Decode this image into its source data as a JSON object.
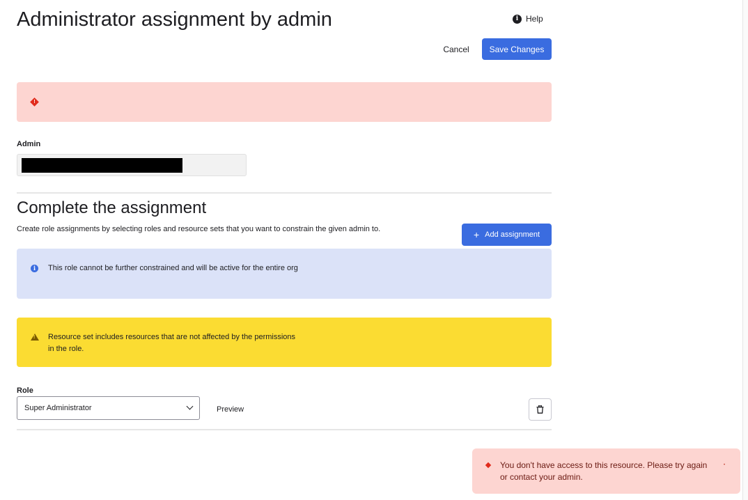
{
  "header": {
    "title": "Administrator assignment by admin",
    "help_label": "Help",
    "help_icon": "info-circle-icon"
  },
  "actions": {
    "cancel_label": "Cancel",
    "save_label": "Save Changes"
  },
  "error_banner": {
    "icon": "error-diamond-icon",
    "text": ""
  },
  "admin_section": {
    "label": "Admin",
    "value_redacted": true
  },
  "assignment": {
    "title": "Complete the assignment",
    "description": "Create role assignments by selecting roles and resource sets that you want to constrain the given admin to.",
    "add_label": "Add assignment",
    "info_callout": {
      "icon": "info-circle-icon",
      "text": "This role cannot be further constrained and will be active for the entire org"
    },
    "warning_callout": {
      "icon": "warning-triangle-icon",
      "text": "Resource set includes resources that are not affected by the permissions in the role."
    },
    "role_label": "Role",
    "role_value": "Super Administrator",
    "preview_label": "Preview",
    "delete_icon": "trash-icon"
  },
  "toast": {
    "icon": "error-diamond-icon",
    "text": "You don't have access to this resource. Please try again or contact your admin."
  },
  "colors": {
    "primary": "#3a6ce0",
    "error_bg": "#fdd5d1",
    "error_accent": "#e12b1c",
    "info_bg": "#dbe2f8",
    "warning_bg": "#fbdc32"
  }
}
